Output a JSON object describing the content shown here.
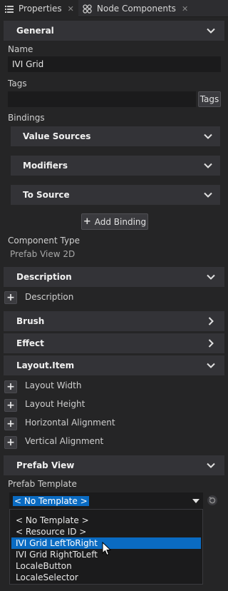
{
  "tabs": [
    {
      "label": "Properties",
      "icon": "list-icon",
      "active": true
    },
    {
      "label": "Node Components",
      "icon": "components-icon",
      "active": false
    }
  ],
  "sections": {
    "general": "General",
    "description": "Description",
    "brush": "Brush",
    "effect": "Effect",
    "layout_item": "Layout.Item",
    "prefab_view": "Prefab View"
  },
  "general": {
    "name_label": "Name",
    "name_value": "IVI Grid",
    "tags_label": "Tags",
    "tags_button": "Tags",
    "bindings_label": "Bindings",
    "bindings": [
      "Value Sources",
      "Modifiers",
      "To Source"
    ],
    "add_binding": "Add Binding",
    "component_type_label": "Component Type",
    "component_type_value": "Prefab View 2D"
  },
  "description": {
    "row": "Description"
  },
  "layout_item": {
    "rows": [
      "Layout Width",
      "Layout Height",
      "Horizontal Alignment",
      "Vertical Alignment"
    ]
  },
  "prefab_view": {
    "template_label": "Prefab Template",
    "selected_value": "< No Template >",
    "options": [
      "< No Template >",
      "< Resource ID >",
      "IVI Grid LeftToRight",
      "IVI Grid RightToLeft",
      "LocaleButton",
      "LocaleSelector"
    ],
    "highlighted_option": "IVI Grid LeftToRight"
  },
  "colors": {
    "background": "#252526",
    "header": "#333337",
    "field": "#1b1b1c",
    "selection": "#0a6bc2"
  }
}
